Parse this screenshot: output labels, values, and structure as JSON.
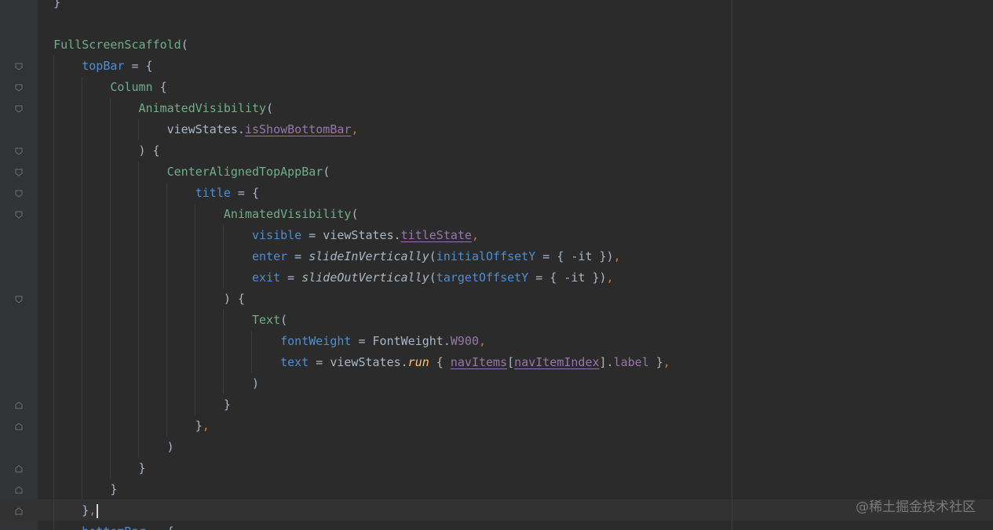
{
  "editor": {
    "lines": [
      {
        "indent": 1,
        "segments": [
          {
            "t": "}",
            "c": "plain"
          }
        ]
      },
      {
        "indent": 0,
        "segments": []
      },
      {
        "indent": 1,
        "segments": [
          {
            "t": "FullScreenScaffold",
            "c": "fn"
          },
          {
            "t": "(",
            "c": "plain"
          }
        ]
      },
      {
        "indent": 2,
        "fold": "open",
        "segments": [
          {
            "t": "topBar",
            "c": "param"
          },
          {
            "t": " = {",
            "c": "plain"
          }
        ]
      },
      {
        "indent": 3,
        "fold": "open",
        "segments": [
          {
            "t": "Column",
            "c": "fn"
          },
          {
            "t": " {",
            "c": "plain"
          }
        ]
      },
      {
        "indent": 4,
        "fold": "open",
        "segments": [
          {
            "t": "AnimatedVisibility",
            "c": "fn"
          },
          {
            "t": "(",
            "c": "plain"
          }
        ]
      },
      {
        "indent": 5,
        "segments": [
          {
            "t": "viewStates.",
            "c": "plain"
          },
          {
            "t": "isShowBottomBar",
            "c": "prop und"
          },
          {
            "t": ",",
            "c": "punct"
          }
        ]
      },
      {
        "indent": 4,
        "fold": "open",
        "segments": [
          {
            "t": ") {",
            "c": "plain"
          }
        ]
      },
      {
        "indent": 5,
        "fold": "open",
        "segments": [
          {
            "t": "CenterAlignedTopAppBar",
            "c": "fn"
          },
          {
            "t": "(",
            "c": "plain"
          }
        ]
      },
      {
        "indent": 6,
        "fold": "open",
        "segments": [
          {
            "t": "title",
            "c": "param"
          },
          {
            "t": " = {",
            "c": "plain"
          }
        ]
      },
      {
        "indent": 7,
        "fold": "open",
        "segments": [
          {
            "t": "AnimatedVisibility",
            "c": "fn"
          },
          {
            "t": "(",
            "c": "plain"
          }
        ]
      },
      {
        "indent": 8,
        "segments": [
          {
            "t": "visible",
            "c": "param"
          },
          {
            "t": " = viewStates.",
            "c": "plain"
          },
          {
            "t": "titleState",
            "c": "prop und"
          },
          {
            "t": ",",
            "c": "punct"
          }
        ]
      },
      {
        "indent": 8,
        "segments": [
          {
            "t": "enter",
            "c": "param"
          },
          {
            "t": " = ",
            "c": "plain"
          },
          {
            "t": "slideInVertically",
            "c": "plain ital"
          },
          {
            "t": "(",
            "c": "plain"
          },
          {
            "t": "initialOffsetY",
            "c": "param"
          },
          {
            "t": " = { -it })",
            "c": "plain"
          },
          {
            "t": ",",
            "c": "punct"
          }
        ]
      },
      {
        "indent": 8,
        "segments": [
          {
            "t": "exit",
            "c": "param"
          },
          {
            "t": " = ",
            "c": "plain"
          },
          {
            "t": "slideOutVertically",
            "c": "plain ital"
          },
          {
            "t": "(",
            "c": "plain"
          },
          {
            "t": "targetOffsetY",
            "c": "param"
          },
          {
            "t": " = { -it })",
            "c": "plain"
          },
          {
            "t": ",",
            "c": "punct"
          }
        ]
      },
      {
        "indent": 7,
        "fold": "open",
        "segments": [
          {
            "t": ") {",
            "c": "plain"
          }
        ]
      },
      {
        "indent": 8,
        "segments": [
          {
            "t": "Text",
            "c": "fn"
          },
          {
            "t": "(",
            "c": "plain"
          }
        ]
      },
      {
        "indent": 9,
        "segments": [
          {
            "t": "fontWeight",
            "c": "param"
          },
          {
            "t": " = FontWeight.",
            "c": "plain"
          },
          {
            "t": "W900",
            "c": "prop"
          },
          {
            "t": ",",
            "c": "punct"
          }
        ]
      },
      {
        "indent": 9,
        "segments": [
          {
            "t": "text",
            "c": "param"
          },
          {
            "t": " = viewStates.",
            "c": "plain"
          },
          {
            "t": "run",
            "c": "ext"
          },
          {
            "t": " { ",
            "c": "plain"
          },
          {
            "t": "navItems",
            "c": "prop und"
          },
          {
            "t": "[",
            "c": "plain"
          },
          {
            "t": "navItemIndex",
            "c": "prop und"
          },
          {
            "t": "].",
            "c": "plain"
          },
          {
            "t": "label",
            "c": "prop"
          },
          {
            "t": " }",
            "c": "plain"
          },
          {
            "t": ",",
            "c": "punct"
          }
        ]
      },
      {
        "indent": 8,
        "segments": [
          {
            "t": ")",
            "c": "plain"
          }
        ]
      },
      {
        "indent": 7,
        "fold": "close",
        "segments": [
          {
            "t": "}",
            "c": "plain"
          }
        ]
      },
      {
        "indent": 6,
        "fold": "close",
        "segments": [
          {
            "t": "}",
            "c": "plain"
          },
          {
            "t": ",",
            "c": "punct"
          }
        ]
      },
      {
        "indent": 5,
        "segments": [
          {
            "t": ")",
            "c": "plain"
          }
        ]
      },
      {
        "indent": 4,
        "fold": "close",
        "segments": [
          {
            "t": "}",
            "c": "plain"
          }
        ]
      },
      {
        "indent": 3,
        "fold": "close",
        "segments": [
          {
            "t": "}",
            "c": "plain"
          }
        ]
      },
      {
        "indent": 2,
        "fold": "close",
        "current": true,
        "segments": [
          {
            "t": "}",
            "c": "plain"
          },
          {
            "t": ",",
            "c": "punct"
          }
        ]
      },
      {
        "indent": 2,
        "segments": [
          {
            "t": "bottomBar",
            "c": "param"
          },
          {
            "t": " = {",
            "c": "plain"
          }
        ]
      }
    ]
  },
  "watermark": "@稀土掘金技术社区",
  "colors": {
    "background": "#2b2b2b",
    "gutter": "#313335",
    "plain": "#a9b7c6",
    "keyword": "#cc7832",
    "function": "#6fae8c",
    "parameter": "#4e8fd2",
    "property": "#9876aa",
    "extension": "#ffc66d"
  }
}
